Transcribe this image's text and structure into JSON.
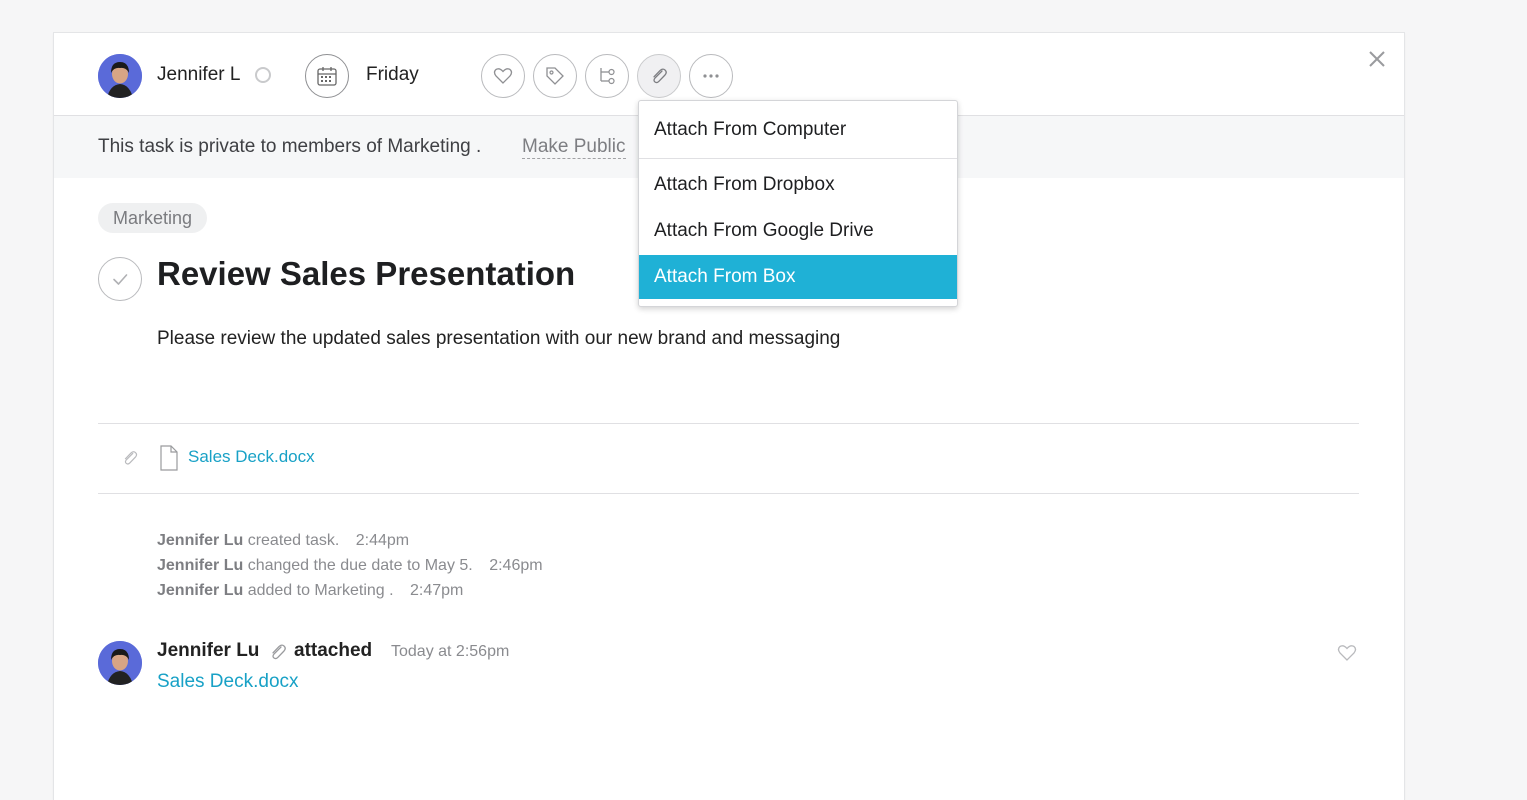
{
  "header": {
    "assignee": "Jennifer L",
    "due_date": "Friday",
    "actions": [
      "heart-icon",
      "tag-icon",
      "subtask-icon",
      "paperclip-icon",
      "more-icon"
    ]
  },
  "privacy": {
    "message": "This task is private to members of Marketing .",
    "make_public": "Make Public"
  },
  "task": {
    "project_tag": "Marketing",
    "title": "Review Sales Presentation",
    "description": "Please review the updated sales presentation with our new brand and messaging"
  },
  "attachments": [
    {
      "name": "Sales Deck.docx"
    }
  ],
  "activity": [
    {
      "actor": "Jennifer Lu",
      "text": "created task.",
      "time": "2:44pm"
    },
    {
      "actor": "Jennifer Lu",
      "text": "changed the due date to May 5.",
      "time": "2:46pm"
    },
    {
      "actor": "Jennifer Lu",
      "text": "added to Marketing .",
      "time": "2:47pm"
    }
  ],
  "comment": {
    "author": "Jennifer Lu",
    "action": "attached",
    "time": "Today at 2:56pm",
    "link": "Sales Deck.docx"
  },
  "attach_menu": {
    "items": [
      "Attach From Computer",
      "Attach From Dropbox",
      "Attach From Google Drive",
      "Attach From Box"
    ],
    "highlighted": "Attach From Box"
  },
  "colors": {
    "accent": "#1fb1d6",
    "link": "#18a1c6",
    "avatar_bg": "#5a6ad9"
  }
}
